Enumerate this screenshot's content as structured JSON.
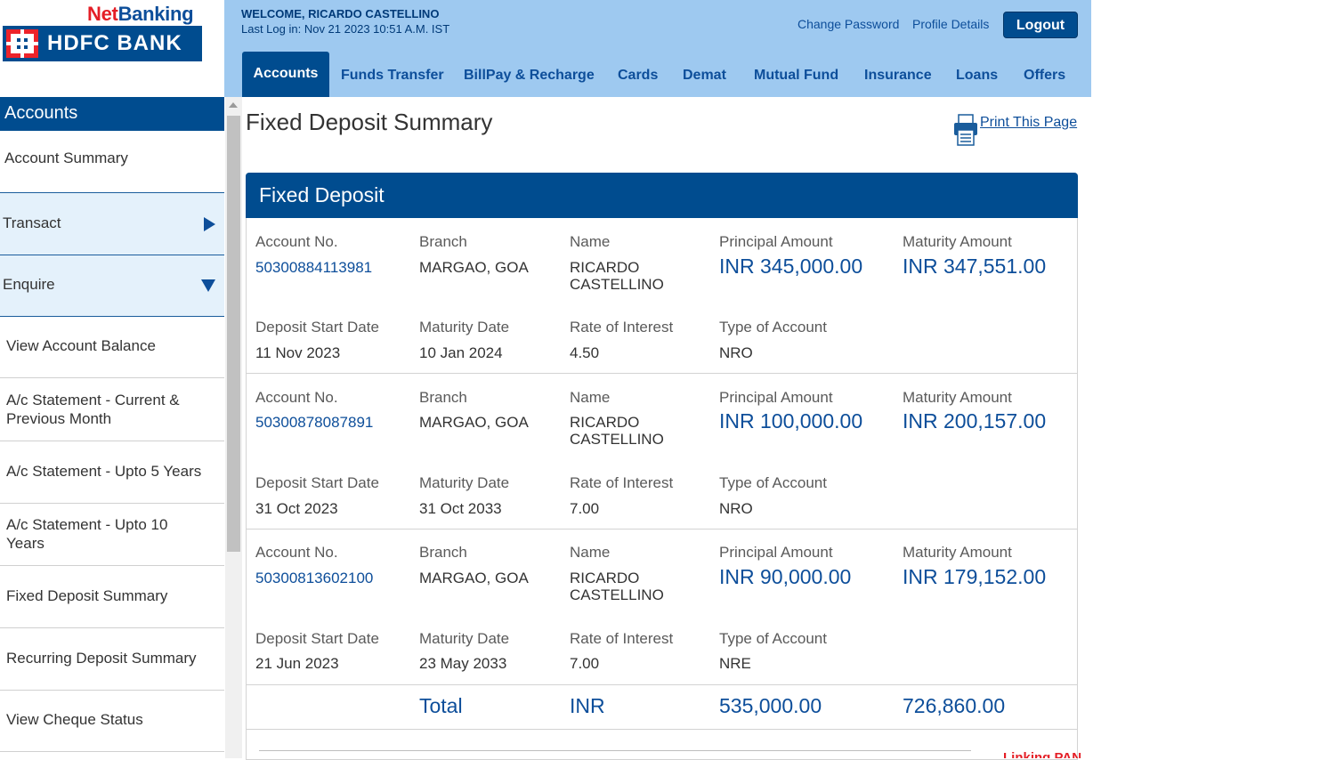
{
  "brand": {
    "net": "Net",
    "banking": "Banking",
    "bank_name": "HDFC BANK"
  },
  "header": {
    "welcome": "WELCOME, RICARDO CASTELLINO",
    "last_login": "Last Log in: Nov 21 2023 10:51 A.M. IST",
    "change_password": "Change Password",
    "profile_details": "Profile Details",
    "logout": "Logout"
  },
  "tabs": [
    "Accounts",
    "Funds Transfer",
    "BillPay & Recharge",
    "Cards",
    "Demat",
    "Mutual Fund",
    "Insurance",
    "Loans",
    "Offers"
  ],
  "sidebar": {
    "title": "Accounts",
    "items": [
      "Account Summary",
      "Transact",
      "Enquire",
      "View Account Balance",
      "A/c Statement - Current & Previous Month",
      "A/c Statement - Upto 5 Years",
      "A/c Statement - Upto 10 Years",
      "Fixed Deposit Summary",
      "Recurring Deposit Summary",
      "View Cheque Status"
    ]
  },
  "page": {
    "title": "Fixed Deposit Summary",
    "print": "Print This Page",
    "panel_title": "Fixed Deposit"
  },
  "labels": {
    "account_no": "Account No.",
    "branch": "Branch",
    "name": "Name",
    "principal": "Principal Amount",
    "maturity_amount": "Maturity Amount",
    "start_date": "Deposit Start Date",
    "maturity_date": "Maturity Date",
    "rate": "Rate of Interest",
    "type": "Type of Account"
  },
  "deposits": [
    {
      "account_no": "50300884113981",
      "branch": "MARGAO, GOA",
      "name_line1": "RICARDO",
      "name_line2": "CASTELLINO",
      "principal": "INR 345,000.00",
      "maturity_amount": "INR 347,551.00",
      "start_date": "11 Nov 2023",
      "maturity_date": "10 Jan 2024",
      "rate": "4.50",
      "type": "NRO"
    },
    {
      "account_no": "50300878087891",
      "branch": "MARGAO, GOA",
      "name_line1": "RICARDO",
      "name_line2": "CASTELLINO",
      "principal": "INR 100,000.00",
      "maturity_amount": "INR 200,157.00",
      "start_date": "31 Oct 2023",
      "maturity_date": "31 Oct 2033",
      "rate": "7.00",
      "type": "NRO"
    },
    {
      "account_no": "50300813602100",
      "branch": "MARGAO, GOA",
      "name_line1": "RICARDO",
      "name_line2": "CASTELLINO",
      "principal": "INR 90,000.00",
      "maturity_amount": "INR 179,152.00",
      "start_date": "21 Jun 2023",
      "maturity_date": "23 May 2033",
      "rate": "7.00",
      "type": "NRE"
    }
  ],
  "total": {
    "label": "Total",
    "currency": "INR",
    "principal": "535,000.00",
    "maturity": "726,860.00"
  },
  "footer_note": "Linking PAN",
  "colors": {
    "header_bg": "#9ec9f0",
    "primary": "#004c8f",
    "brand_red": "#e41e26",
    "sidebar_highlight": "#e4f1fb"
  }
}
